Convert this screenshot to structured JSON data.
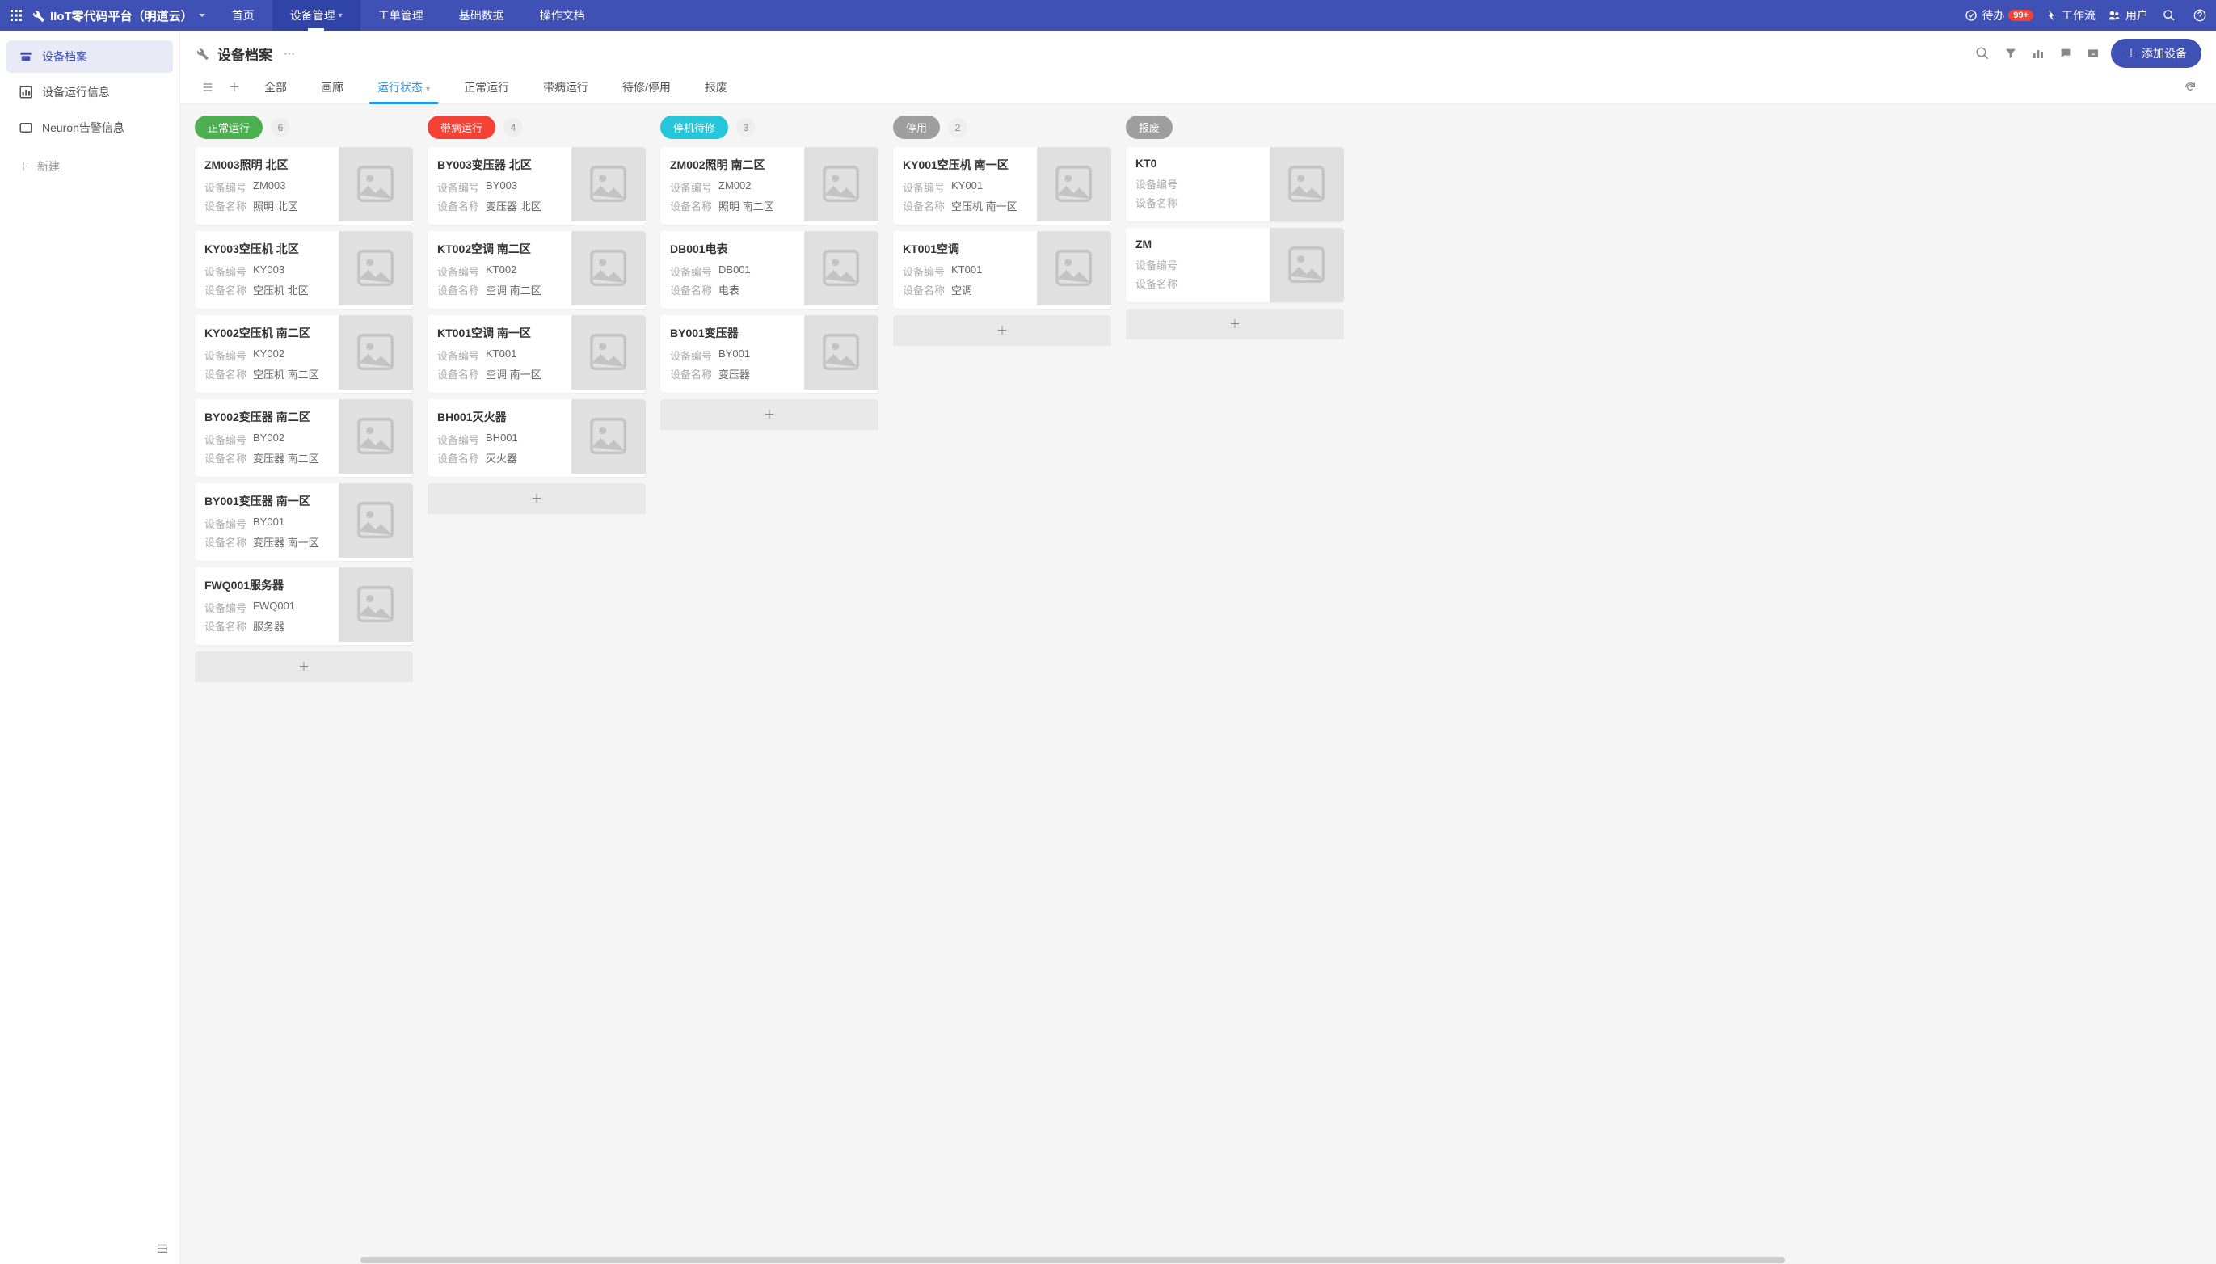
{
  "topbar": {
    "app_title": "IIoT零代码平台（明道云）",
    "nav": [
      "首页",
      "设备管理",
      "工单管理",
      "基础数据",
      "操作文档"
    ],
    "active_nav_index": 1,
    "todo_label": "待办",
    "todo_badge": "99+",
    "workflow_label": "工作流",
    "user_label": "用户"
  },
  "sidebar": {
    "items": [
      {
        "label": "设备档案"
      },
      {
        "label": "设备运行信息"
      },
      {
        "label": "Neuron告警信息"
      }
    ],
    "active_index": 0,
    "new_label": "新建"
  },
  "page": {
    "title": "设备档案",
    "add_button": "添加设备"
  },
  "tabs": {
    "items": [
      "全部",
      "画廊",
      "运行状态",
      "正常运行",
      "带病运行",
      "待修/停用",
      "报废"
    ],
    "active_index": 2
  },
  "field_labels": {
    "code": "设备编号",
    "name": "设备名称"
  },
  "columns": [
    {
      "pill": "正常运行",
      "pill_color": "green",
      "count": 6,
      "cards": [
        {
          "title": "ZM003照明 北区",
          "code": "ZM003",
          "name": "照明 北区"
        },
        {
          "title": "KY003空压机 北区",
          "code": "KY003",
          "name": "空压机 北区"
        },
        {
          "title": "KY002空压机 南二区",
          "code": "KY002",
          "name": "空压机 南二区"
        },
        {
          "title": "BY002变压器 南二区",
          "code": "BY002",
          "name": "变压器 南二区"
        },
        {
          "title": "BY001变压器 南一区",
          "code": "BY001",
          "name": "变压器 南一区"
        },
        {
          "title": "FWQ001服务器",
          "code": "FWQ001",
          "name": "服务器"
        }
      ]
    },
    {
      "pill": "带病运行",
      "pill_color": "red",
      "count": 4,
      "cards": [
        {
          "title": "BY003变压器 北区",
          "code": "BY003",
          "name": "变压器 北区"
        },
        {
          "title": "KT002空调 南二区",
          "code": "KT002",
          "name": "空调 南二区"
        },
        {
          "title": "KT001空调 南一区",
          "code": "KT001",
          "name": "空调 南一区"
        },
        {
          "title": "BH001灭火器",
          "code": "BH001",
          "name": "灭火器"
        }
      ]
    },
    {
      "pill": "停机待修",
      "pill_color": "teal",
      "count": 3,
      "cards": [
        {
          "title": "ZM002照明 南二区",
          "code": "ZM002",
          "name": "照明 南二区"
        },
        {
          "title": "DB001电表",
          "code": "DB001",
          "name": "电表"
        },
        {
          "title": "BY001变压器",
          "code": "BY001",
          "name": "变压器"
        }
      ]
    },
    {
      "pill": "停用",
      "pill_color": "gray",
      "count": 2,
      "cards": [
        {
          "title": "KY001空压机 南一区",
          "code": "KY001",
          "name": "空压机 南一区"
        },
        {
          "title": "KT001空调",
          "code": "KT001",
          "name": "空调"
        }
      ]
    },
    {
      "pill": "报废",
      "pill_color": "gray",
      "count": null,
      "cards": [
        {
          "title": "KT0",
          "code": "",
          "name": ""
        },
        {
          "title": "ZM",
          "code": "",
          "name": ""
        }
      ]
    }
  ]
}
